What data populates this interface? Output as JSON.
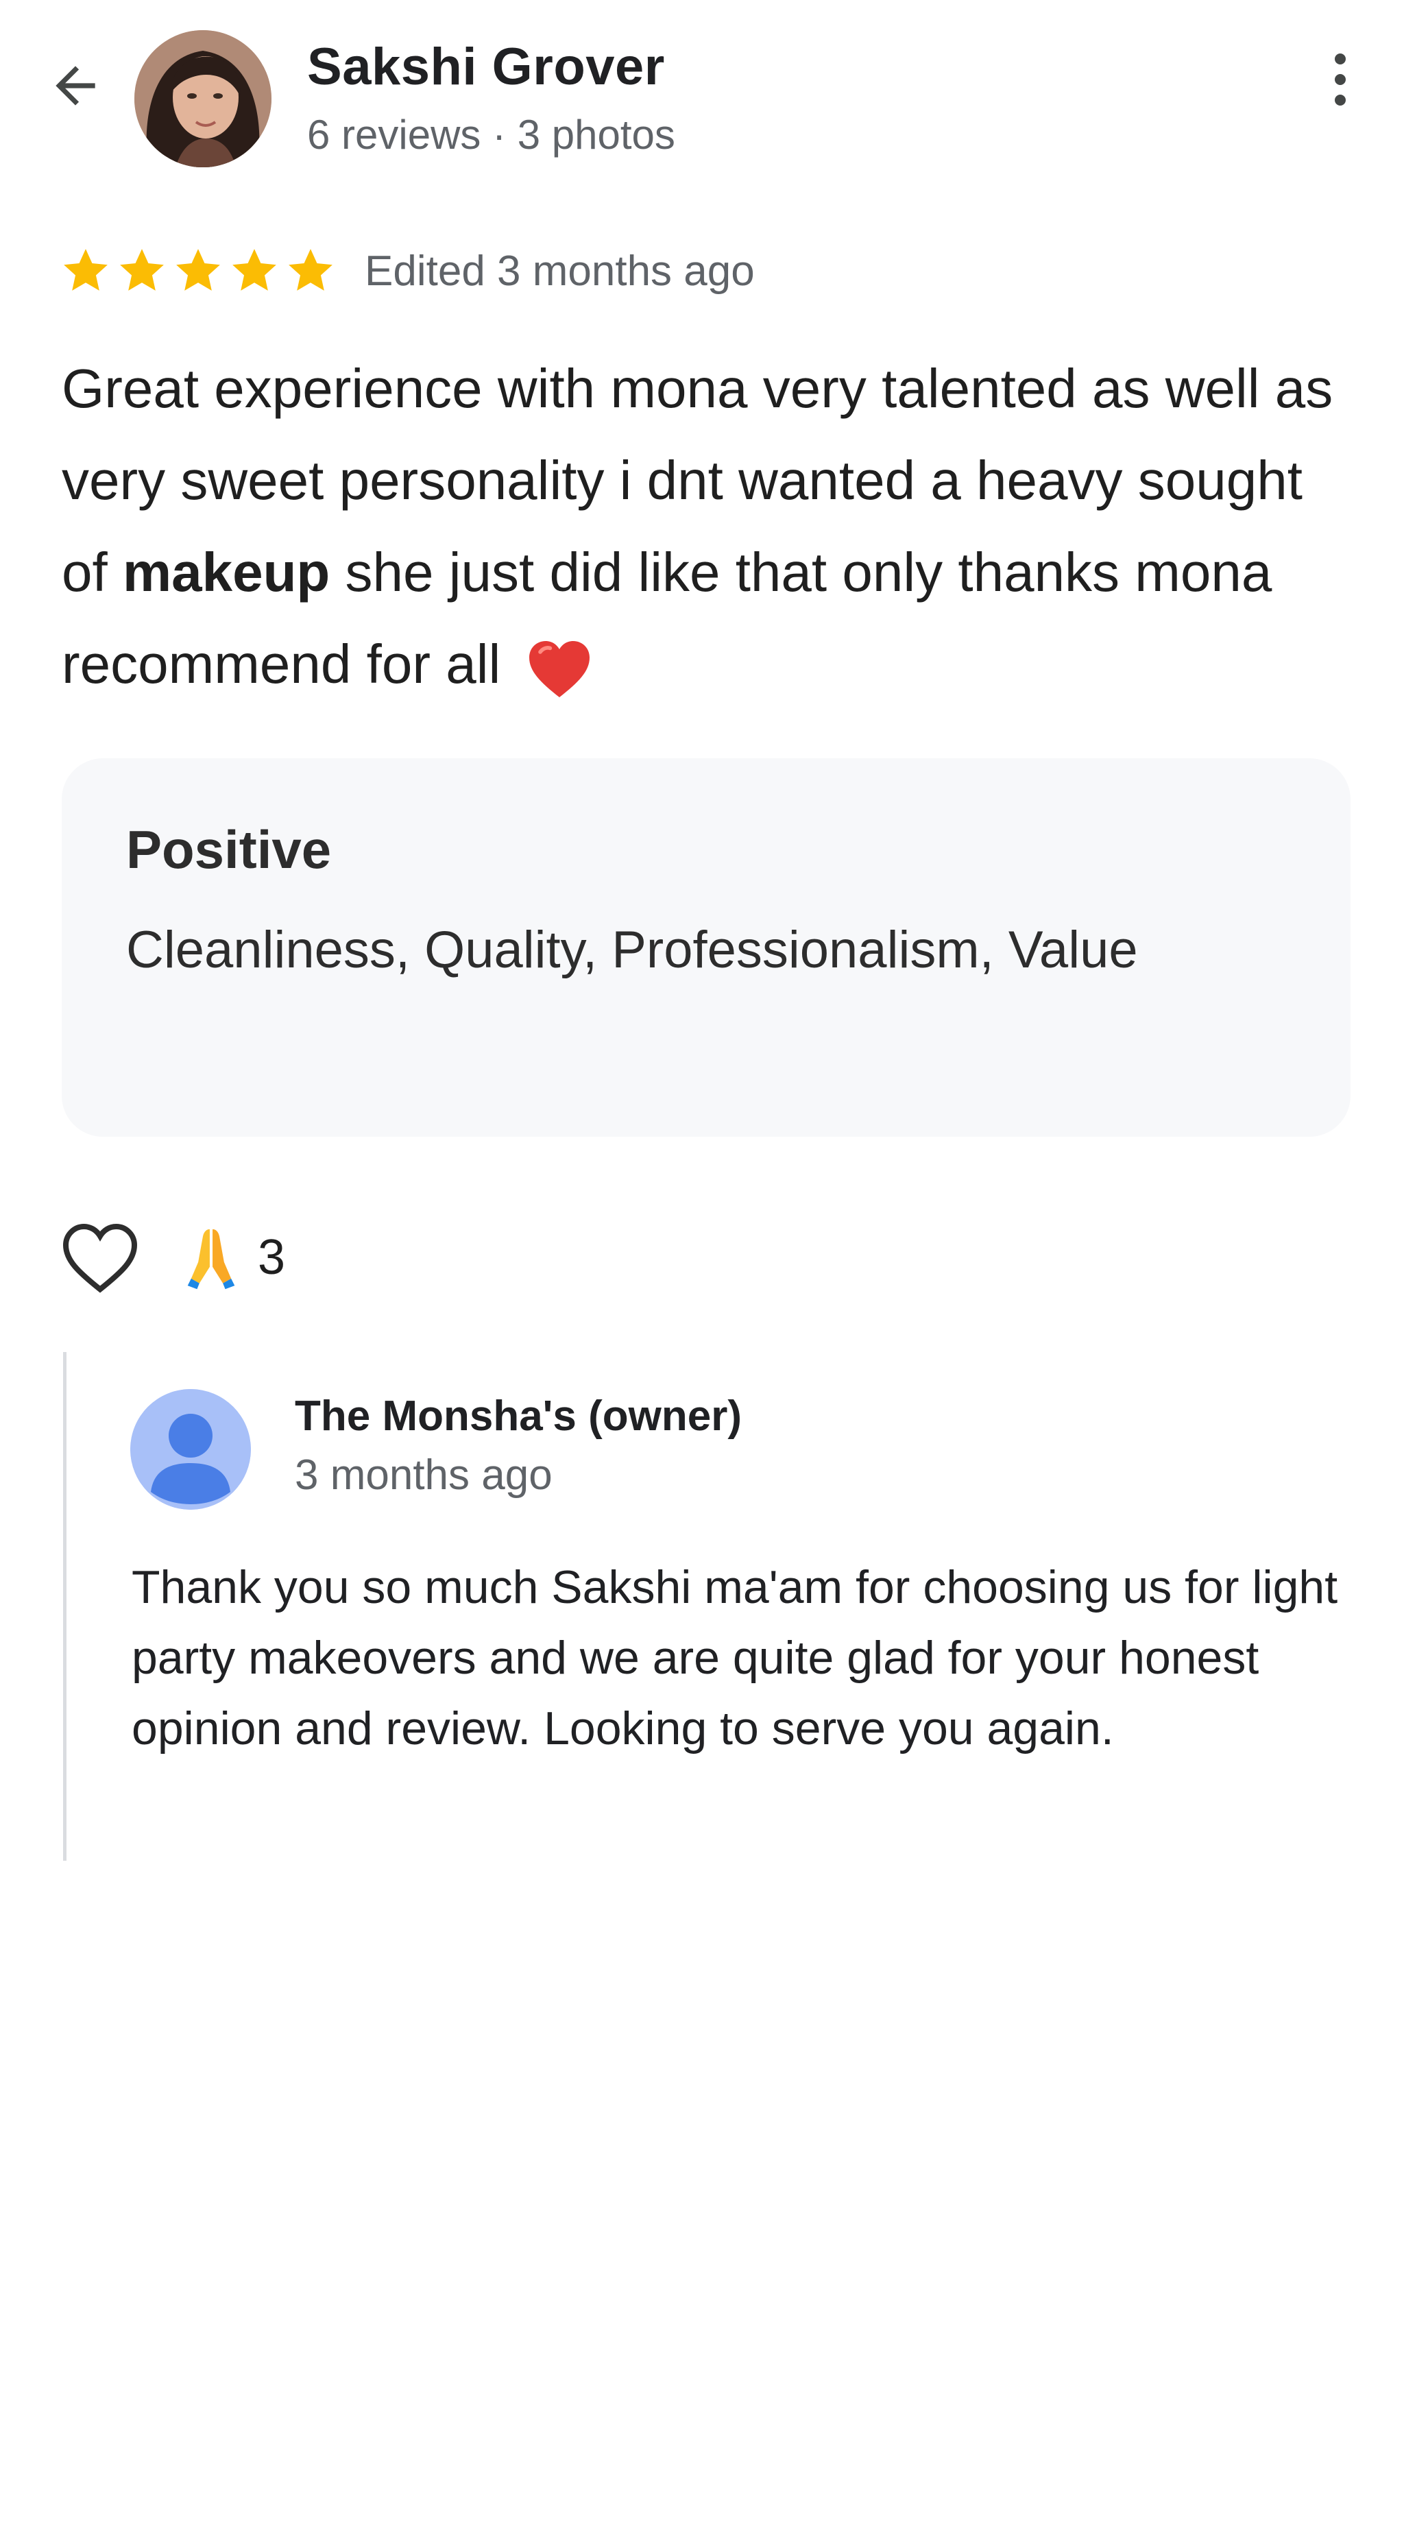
{
  "header": {
    "reviewer_name": "Sakshi Grover",
    "reviewer_meta": "6 reviews · 3 photos",
    "back_icon": "arrow-back-icon",
    "more_icon": "more-vert-icon"
  },
  "review": {
    "rating": 5,
    "rating_max": 5,
    "edited_label": "Edited 3 months ago",
    "text_before_bold": "Great experience with mona very talented as well as very sweet personality i dnt wanted a heavy sought of ",
    "text_bold": "makeup",
    "text_after_bold": " she just did like that only thanks mona recommend for all",
    "emoji_icon": "red-heart-emoji",
    "star_color": "#fbbc04"
  },
  "positive": {
    "title": "Positive",
    "values": "Cleanliness, Quality, Professionalism, Value"
  },
  "reactions": {
    "like_icon": "heart-outline-icon",
    "reaction_icon": "folded-hands-emoji",
    "count": "3"
  },
  "owner_reply": {
    "name": "The Monsha's (owner)",
    "time": "3 months ago",
    "text": "Thank you so much Sakshi ma'am for choosing us for light party makeovers and we are quite glad for your honest opinion and review. Looking to serve you again.",
    "avatar_icon": "default-person-avatar-icon"
  }
}
